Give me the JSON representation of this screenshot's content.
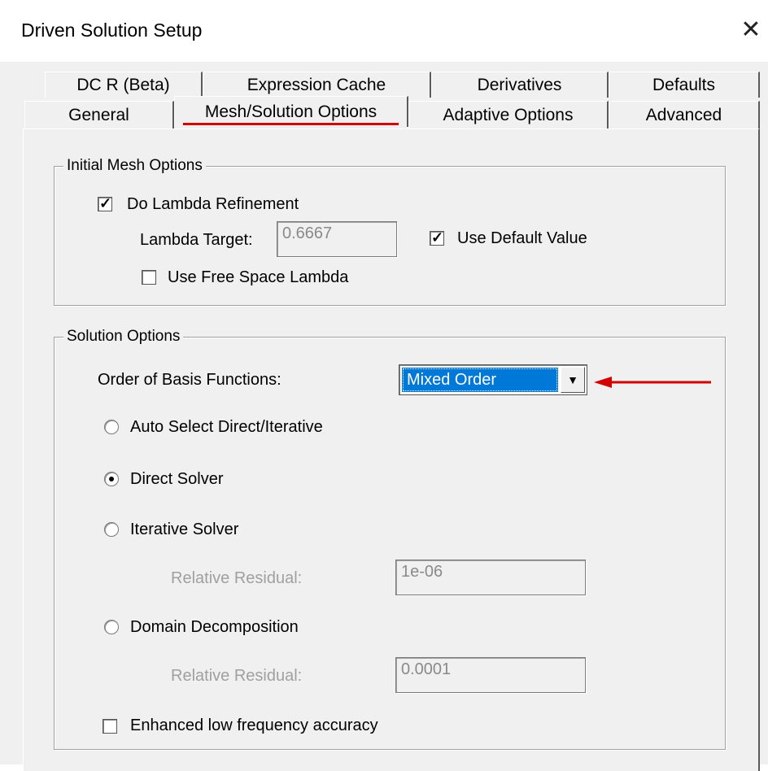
{
  "window": {
    "title": "Driven Solution Setup",
    "close_glyph": "✕"
  },
  "tabs": {
    "row_back": [
      "DC R (Beta)",
      "Expression Cache",
      "Derivatives",
      "Defaults"
    ],
    "row_front": [
      "General",
      "Mesh/Solution Options",
      "Adaptive Options",
      "Advanced"
    ],
    "active": "Mesh/Solution Options"
  },
  "initial_mesh": {
    "legend": "Initial Mesh Options",
    "do_lambda_refinement": {
      "label": "Do Lambda Refinement",
      "checked": true
    },
    "lambda_target_label": "Lambda Target:",
    "lambda_target_value": "0.6667",
    "use_default_value": {
      "label": "Use Default Value",
      "checked": true
    },
    "use_free_space_lambda": {
      "label": "Use Free Space Lambda",
      "checked": false
    }
  },
  "solution_options": {
    "legend": "Solution Options",
    "basis_label": "Order of Basis Functions:",
    "basis_value": "Mixed Order",
    "radios": {
      "auto": "Auto Select Direct/Iterative",
      "direct": "Direct Solver",
      "iterative": "Iterative Solver",
      "domain": "Domain Decomposition"
    },
    "selected": "direct",
    "iterative_residual_label": "Relative Residual:",
    "iterative_residual_value": "1e-06",
    "domain_residual_label": "Relative Residual:",
    "domain_residual_value": "0.0001",
    "enhanced_low_freq": {
      "label": "Enhanced low frequency accuracy",
      "checked": false
    }
  },
  "colors": {
    "highlight": "#0078d7",
    "annotation_red": "#d20000",
    "dialog_bg": "#f0f0f0"
  },
  "icons": {
    "check": "checkmark-icon",
    "dropdown": "chevron-down-icon",
    "annotation": "red-arrow-icon"
  }
}
